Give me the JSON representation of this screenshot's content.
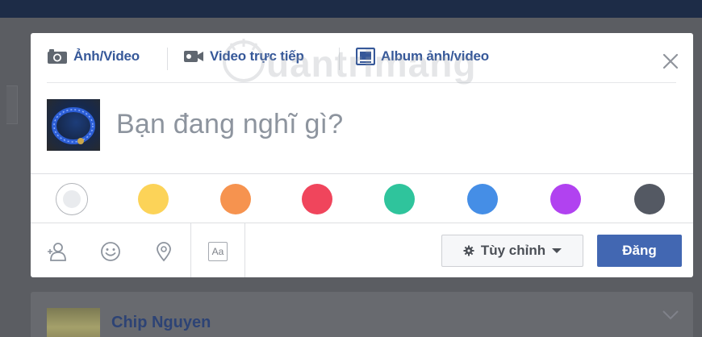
{
  "composer": {
    "tabs": [
      {
        "label": "Ảnh/Video",
        "icon": "camera-icon"
      },
      {
        "label": "Video trực tiếp",
        "icon": "video-camera-icon"
      },
      {
        "label": "Album ảnh/video",
        "icon": "album-icon"
      }
    ],
    "close_icon": "close-icon",
    "prompt": "Bạn đang nghĩ gì?",
    "background_colors": [
      {
        "name": "none",
        "color": "#e9ebee"
      },
      {
        "name": "yellow",
        "color": "#fcd358"
      },
      {
        "name": "orange",
        "color": "#f6934f"
      },
      {
        "name": "red",
        "color": "#f0455c"
      },
      {
        "name": "teal",
        "color": "#2fc49c"
      },
      {
        "name": "blue",
        "color": "#458ee6"
      },
      {
        "name": "purple",
        "color": "#b142f0"
      },
      {
        "name": "gray",
        "color": "#545963"
      }
    ],
    "actions": {
      "tag_icon": "tag-friends-icon",
      "feeling_icon": "smiley-icon",
      "location_icon": "location-pin-icon",
      "text_format_label": "Aa",
      "audience_label": "Tùy chỉnh",
      "post_label": "Đăng"
    },
    "accent_color": "#4267b2"
  },
  "feed": {
    "post_author": "Chip Nguyen"
  }
}
